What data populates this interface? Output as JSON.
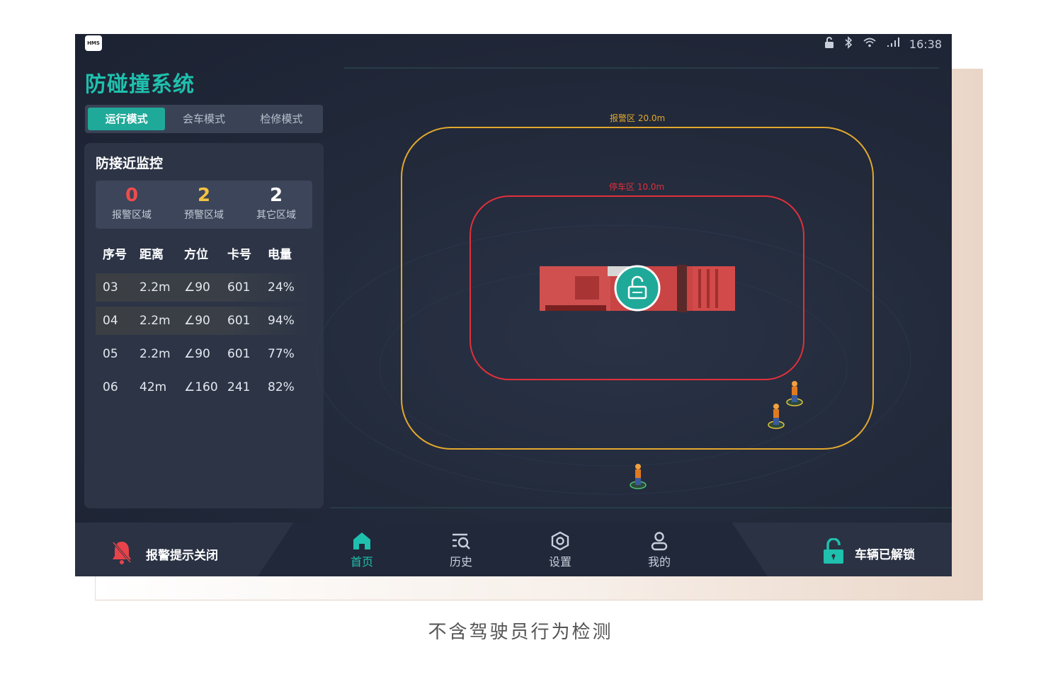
{
  "status_bar": {
    "logo": "HMS",
    "time": "16:38",
    "icons": [
      "lock-icon",
      "bluetooth-icon",
      "wifi-icon",
      "signal-icon"
    ]
  },
  "app_title": "防碰撞系统",
  "mode_tabs": [
    {
      "label": "运行模式",
      "active": true
    },
    {
      "label": "会车模式",
      "active": false
    },
    {
      "label": "检修模式",
      "active": false
    }
  ],
  "monitor": {
    "title": "防接近监控",
    "summary": [
      {
        "value": "0",
        "label": "报警区域",
        "color": "#f04b4b"
      },
      {
        "value": "2",
        "label": "预警区域",
        "color": "#f5c342"
      },
      {
        "value": "2",
        "label": "其它区域",
        "color": "#ffffff"
      }
    ],
    "columns": [
      "序号",
      "距离",
      "方位",
      "卡号",
      "电量"
    ],
    "rows": [
      [
        "03",
        "2.2m",
        "∠90",
        "601",
        "24%"
      ],
      [
        "04",
        "2.2m",
        "∠90",
        "601",
        "94%"
      ],
      [
        "05",
        "2.2m",
        "∠90",
        "601",
        "77%"
      ],
      [
        "06",
        "42m",
        "∠160",
        "241",
        "82%"
      ]
    ]
  },
  "zones": {
    "warning": {
      "label": "报警区 20.0m",
      "color": "#e2a82e"
    },
    "stop": {
      "label": "停车区 10.0m",
      "color": "#e0303a"
    }
  },
  "bottom_bar": {
    "alarm_label": "报警提示关闭",
    "nav": [
      {
        "label": "首页",
        "icon": "home-icon",
        "active": true
      },
      {
        "label": "历史",
        "icon": "history-icon",
        "active": false
      },
      {
        "label": "设置",
        "icon": "settings-icon",
        "active": false
      },
      {
        "label": "我的",
        "icon": "profile-icon",
        "active": false
      }
    ],
    "lock_label": "车辆已解锁"
  },
  "caption": "不含驾驶员行为检测",
  "colors": {
    "accent": "#1fc0ad",
    "alarm": "#f04b4b",
    "warning": "#f5c342"
  }
}
